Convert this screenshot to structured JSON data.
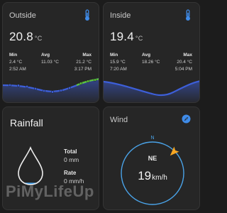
{
  "outside": {
    "title": "Outside",
    "icon": "thermometer-icon",
    "temperature": "20.8",
    "unit": "°C",
    "min_label": "Min",
    "min_value": "2.4 °C",
    "min_time": "2:52 AM",
    "avg_label": "Avg",
    "avg_value": "11.03 °C",
    "max_label": "Max",
    "max_value": "21.2 °C",
    "max_time": "3:17 PM",
    "line_color": "#3d5fd9",
    "highlight_color": "#5cc33a"
  },
  "inside": {
    "title": "Inside",
    "icon": "thermometer-icon",
    "temperature": "19.4",
    "unit": "°C",
    "min_label": "Min",
    "min_value": "15.9 °C",
    "min_time": "7:20 AM",
    "avg_label": "Avg",
    "avg_value": "18.26 °C",
    "max_label": "Max",
    "max_value": "20.4 °C",
    "max_time": "5:04 PM",
    "line_color": "#3d5fd9"
  },
  "rainfall": {
    "title": "Rainfall",
    "total_label": "Total",
    "total_value": "0 mm",
    "rate_label": "Rate",
    "rate_value": "0 mm/h",
    "fill_fraction": 0.05,
    "fill_color": "#42a5f5"
  },
  "wind": {
    "title": "Wind",
    "icon": "compass-icon",
    "north_label": "N",
    "direction": "NE",
    "speed": "19",
    "speed_unit": "km/h",
    "bearing_degrees": 45,
    "ring_color": "#4aa3e8",
    "arrow_color": "#f5a623"
  },
  "watermark": "PiMyLifeUp"
}
